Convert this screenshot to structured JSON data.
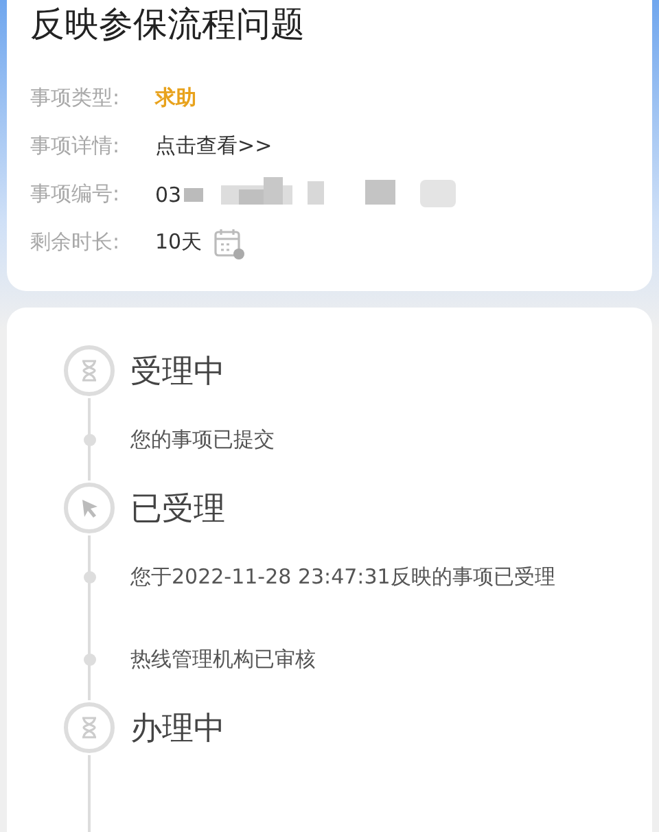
{
  "title": "反映参保流程问题",
  "fields": [
    {
      "label": "事项类型:",
      "value": "求助",
      "kind": "type"
    },
    {
      "label": "事项详情:",
      "value": "点击查看>>",
      "kind": "link"
    },
    {
      "label": "事项编号:",
      "value": "03",
      "kind": "redacted"
    },
    {
      "label": "剩余时长:",
      "value": "10天",
      "kind": "calendar"
    }
  ],
  "timeline": [
    {
      "stage": "受理中",
      "kind": "hourglass",
      "events": [
        "您的事项已提交"
      ]
    },
    {
      "stage": "已受理",
      "kind": "pointer",
      "events": [
        "您于2022-11-28 23:47:31反映的事项已受理",
        "热线管理机构已审核"
      ]
    },
    {
      "stage": "办理中",
      "kind": "hourglass"
    }
  ]
}
